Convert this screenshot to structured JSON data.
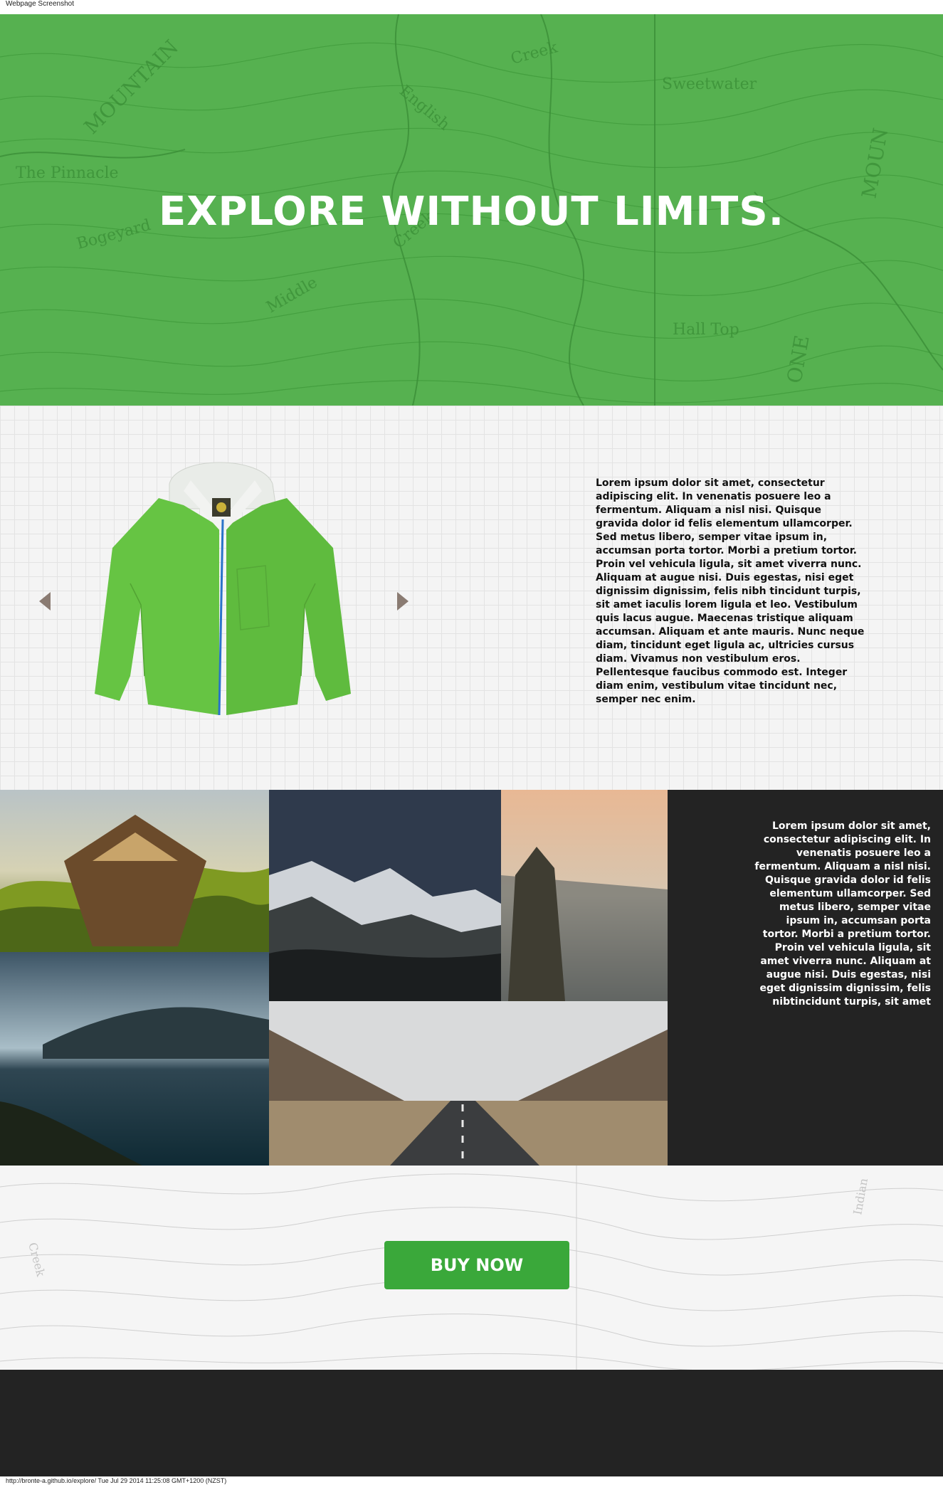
{
  "window": {
    "title": "Webpage Screenshot"
  },
  "hero": {
    "title": "EXPLORE WITHOUT LIMITS.",
    "map_labels": [
      "Creek",
      "English",
      "Sweetwater",
      "The Pinnacle",
      "Bogeyard",
      "Creek",
      "Middle",
      "Hall Top",
      "MOUNTAIN",
      "MOUN",
      "ONE"
    ]
  },
  "product": {
    "image_name": "green-rain-jacket",
    "description": "Lorem ipsum dolor sit amet, consectetur adipiscing elit. In venenatis posuere leo a fermentum. Aliquam a nisl nisi. Quisque gravida dolor id felis elementum ullamcorper. Sed metus libero, semper vitae ipsum in, accumsan porta tortor. Morbi a pretium tortor. Proin vel vehicula ligula, sit amet viverra nunc. Aliquam at augue nisi. Duis egestas, nisi eget dignissim dignissim, felis nibh tincidunt turpis, sit amet iaculis lorem ligula et leo. Vestibulum quis lacus augue. Maecenas tristique aliquam accumsan. Aliquam et ante mauris. Nunc neque diam, tincidunt eget ligula ac, ultricies cursus diam. Vivamus non vestibulum eros. Pellentesque faucibus commodo est. Integer diam enim, vestibulum vitae tincidunt nec, semper nec enim.",
    "prev_icon": "arrow-left-icon",
    "next_icon": "arrow-right-icon"
  },
  "gallery": {
    "photos": [
      "canoe-in-grass",
      "snowy-mountains-night",
      "cliff-at-dusk",
      "lake-and-hills",
      "empty-road-valley"
    ],
    "text": "Lorem ipsum dolor sit amet, consectetur adipiscing elit. In venenatis posuere leo a fermentum. Aliquam a nisl nisi. Quisque gravida dolor id felis elementum ullamcorper. Sed metus libero, semper vitae ipsum in, accumsan porta tortor. Morbi a pretium tortor. Proin vel vehicula ligula, sit amet viverra nunc. Aliquam at augue nisi. Duis egestas, nisi eget dignissim dignissim, felis nibtincidunt turpis, sit amet"
  },
  "cta": {
    "button_label": "BUY NOW",
    "map_labels": [
      "Creek",
      "Indian"
    ]
  },
  "colors": {
    "hero_green": "#56b150",
    "button_green": "#3aa83a",
    "dark": "#232323"
  },
  "status": {
    "url_line": "http://bronte-a.github.io/explore/ Tue Jul 29 2014 11:25:08 GMT+1200 (NZST)"
  }
}
